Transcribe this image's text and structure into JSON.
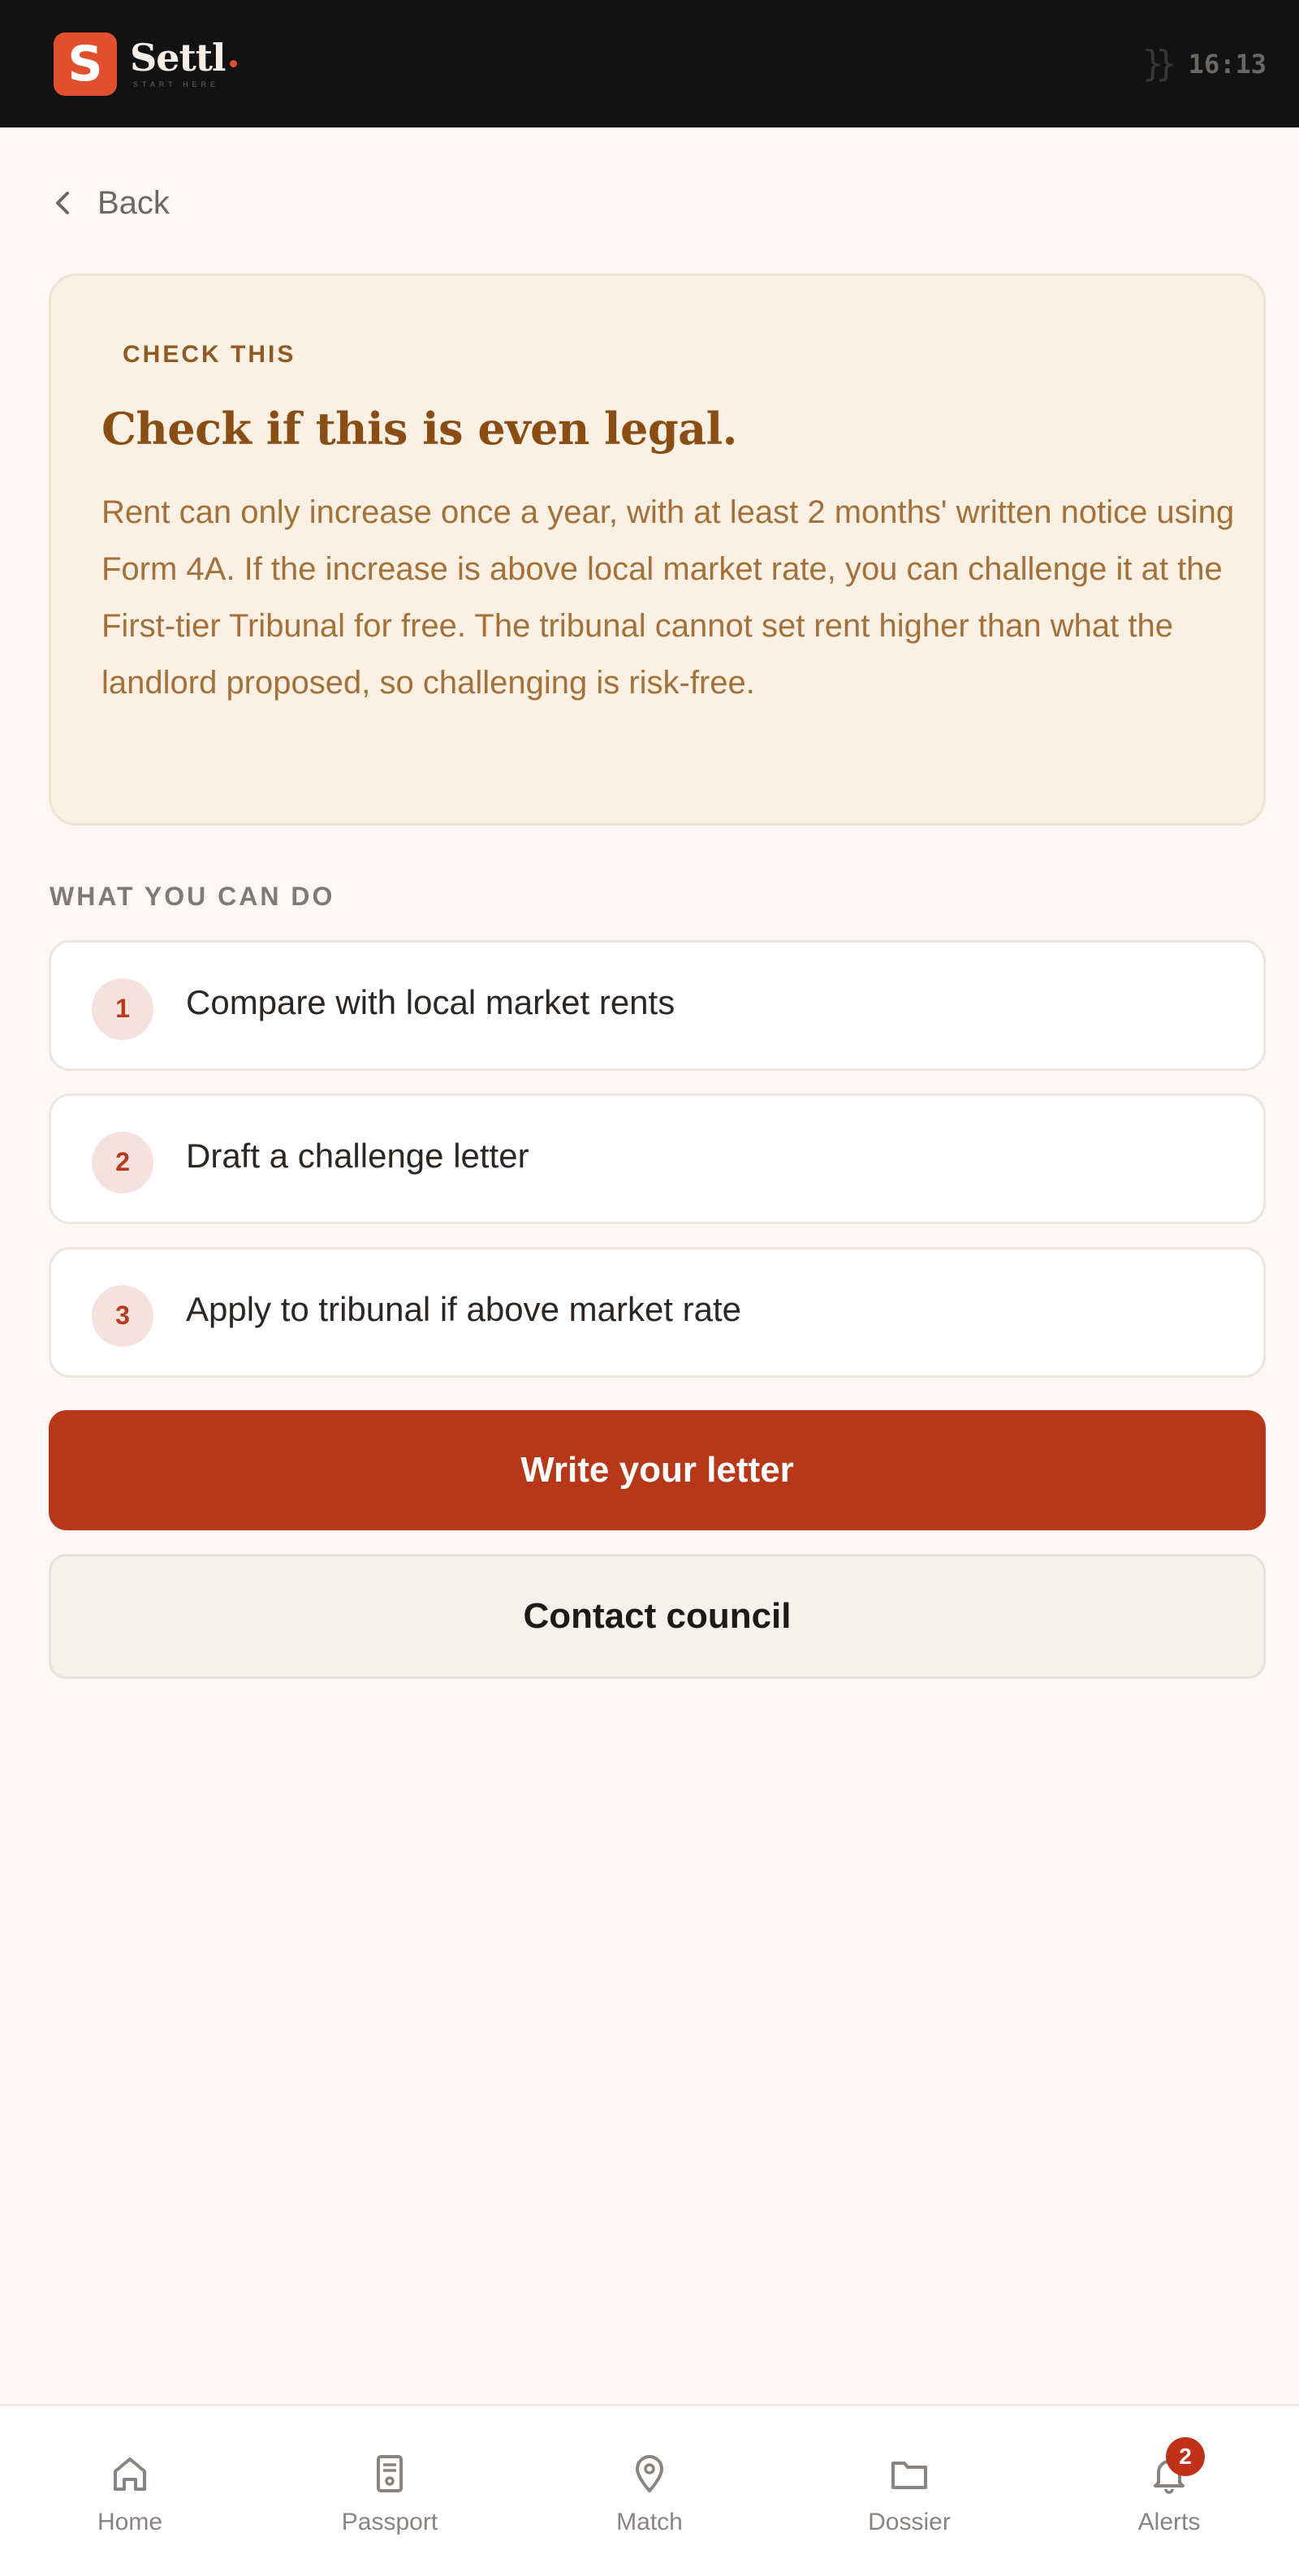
{
  "header": {
    "brand_initial": "S",
    "brand_name": "Settl",
    "brand_tagline": "START HERE",
    "time": "16:13",
    "colors": {
      "bar": "#131212",
      "brand_accent": "#e0502e"
    }
  },
  "back": {
    "label": "Back",
    "icon": "chevron-left-icon"
  },
  "info_card": {
    "eyebrow": "CHECK THIS",
    "title": "Check if this is even legal.",
    "body": "Rent can only increase once a year, with at least 2 months' written notice using Form 4A. If the increase is above local market rate, you can challenge it at the First-tier Tribunal for free. The tribunal cannot set rent higher than what the landlord proposed, so challenging is risk-free.",
    "colors": {
      "background": "#fbf0e4",
      "title": "#8a4e15",
      "body": "#a37139"
    }
  },
  "actions_section": {
    "label": "WHAT YOU CAN DO",
    "steps": [
      {
        "number": "1",
        "label": "Compare with local market rents"
      },
      {
        "number": "2",
        "label": "Draft a challenge letter"
      },
      {
        "number": "3",
        "label": "Apply to tribunal if above market rate"
      }
    ]
  },
  "buttons": {
    "primary_label": "Write your letter",
    "secondary_label": "Contact council",
    "primary_color": "#b73818"
  },
  "bottom_nav": {
    "items": [
      {
        "label": "Home",
        "icon": "home-icon"
      },
      {
        "label": "Passport",
        "icon": "passport-icon"
      },
      {
        "label": "Match",
        "icon": "location-pin-icon"
      },
      {
        "label": "Dossier",
        "icon": "folder-icon"
      },
      {
        "label": "Alerts",
        "icon": "bell-icon",
        "badge": "2"
      }
    ]
  }
}
